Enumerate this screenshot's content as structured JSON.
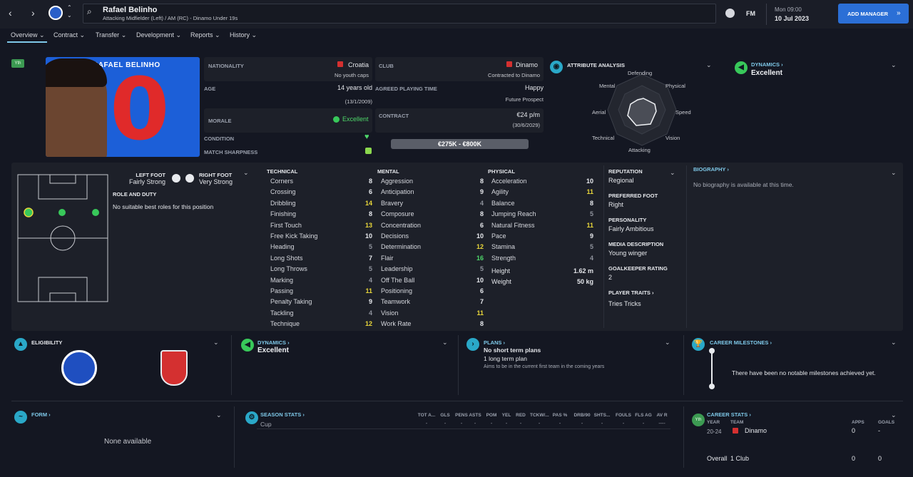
{
  "topbar": {
    "player_name": "Rafael Belinho",
    "player_sub": "Attacking Midfielder (Left) / AM (RC) - Dinamo Under 19s",
    "fm": "FM",
    "time": "Mon 09:00",
    "date": "10 Jul 2023",
    "add_manager": "ADD MANAGER"
  },
  "tabs": [
    "Overview",
    "Contract",
    "Transfer",
    "Development",
    "Reports",
    "History"
  ],
  "profile": {
    "badge": "Yth",
    "shirt_name": "RAFAEL BELINHO",
    "shirt_number": "0",
    "nationality_label": "NATIONALITY",
    "nationality": "Croatia",
    "youth_caps": "No youth caps",
    "age_label": "AGE",
    "age": "14 years old",
    "dob": "(13/1/2009)",
    "morale_label": "MORALE",
    "morale": "Excellent",
    "condition_label": "CONDITION",
    "sharpness_label": "MATCH SHARPNESS",
    "club_label": "CLUB",
    "club": "Dinamo",
    "contracted": "Contracted to Dinamo",
    "playing_time_label": "AGREED PLAYING TIME",
    "happy": "Happy",
    "playing_time": "Future Prospect",
    "contract_label": "CONTRACT",
    "wage": "€24 p/m",
    "expiry": "(30/6/2029)",
    "value": "€275K - €800K"
  },
  "attribute_analysis": {
    "title": "ATTRIBUTE ANALYSIS",
    "labels": [
      "Defending",
      "Physical",
      "Speed",
      "Vision",
      "Attacking",
      "Technical",
      "Aerial",
      "Mental"
    ]
  },
  "dynamics_top": {
    "title": "DYNAMICS",
    "value": "Excellent"
  },
  "position": {
    "left_foot_label": "LEFT FOOT",
    "left_foot": "Fairly Strong",
    "right_foot_label": "RIGHT FOOT",
    "right_foot": "Very Strong",
    "role_title": "ROLE AND DUTY",
    "role_text": "No suitable best roles for this position"
  },
  "technical": {
    "title": "TECHNICAL",
    "items": [
      [
        "Corners",
        "8",
        "w"
      ],
      [
        "Crossing",
        "6",
        "w"
      ],
      [
        "Dribbling",
        "14",
        "y"
      ],
      [
        "Finishing",
        "8",
        "w"
      ],
      [
        "First Touch",
        "13",
        "y"
      ],
      [
        "Free Kick Taking",
        "10",
        "w"
      ],
      [
        "Heading",
        "5",
        "gr"
      ],
      [
        "Long Shots",
        "7",
        "w"
      ],
      [
        "Long Throws",
        "5",
        "gr"
      ],
      [
        "Marking",
        "4",
        "gr"
      ],
      [
        "Passing",
        "11",
        "y"
      ],
      [
        "Penalty Taking",
        "9",
        "w"
      ],
      [
        "Tackling",
        "4",
        "gr"
      ],
      [
        "Technique",
        "12",
        "y"
      ]
    ]
  },
  "mental": {
    "title": "MENTAL",
    "items": [
      [
        "Aggression",
        "8",
        "w"
      ],
      [
        "Anticipation",
        "9",
        "w"
      ],
      [
        "Bravery",
        "4",
        "gr"
      ],
      [
        "Composure",
        "8",
        "w"
      ],
      [
        "Concentration",
        "6",
        "w"
      ],
      [
        "Decisions",
        "10",
        "w"
      ],
      [
        "Determination",
        "12",
        "y"
      ],
      [
        "Flair",
        "16",
        "g"
      ],
      [
        "Leadership",
        "5",
        "gr"
      ],
      [
        "Off The Ball",
        "10",
        "w"
      ],
      [
        "Positioning",
        "6",
        "w"
      ],
      [
        "Teamwork",
        "7",
        "w"
      ],
      [
        "Vision",
        "11",
        "y"
      ],
      [
        "Work Rate",
        "8",
        "w"
      ]
    ]
  },
  "physical": {
    "title": "PHYSICAL",
    "items": [
      [
        "Acceleration",
        "10",
        "w"
      ],
      [
        "Agility",
        "11",
        "y"
      ],
      [
        "Balance",
        "8",
        "w"
      ],
      [
        "Jumping Reach",
        "5",
        "gr"
      ],
      [
        "Natural Fitness",
        "11",
        "y"
      ],
      [
        "Pace",
        "9",
        "w"
      ],
      [
        "Stamina",
        "5",
        "gr"
      ],
      [
        "Strength",
        "4",
        "gr"
      ]
    ],
    "height_label": "Height",
    "height": "1.62 m",
    "weight_label": "Weight",
    "weight": "50 kg"
  },
  "info": {
    "reputation_label": "REPUTATION",
    "reputation": "Regional",
    "foot_label": "PREFERRED FOOT",
    "foot": "Right",
    "personality_label": "PERSONALITY",
    "personality": "Fairly Ambitious",
    "media_label": "MEDIA DESCRIPTION",
    "media": "Young winger",
    "gk_label": "GOALKEEPER RATING",
    "gk": "2",
    "traits_label": "PLAYER TRAITS",
    "traits": "Tries Tricks"
  },
  "biography": {
    "title": "BIOGRAPHY",
    "text": "No biography is available at this time."
  },
  "eligibility": {
    "title": "ELIGIBILITY"
  },
  "dynamics_mid": {
    "title": "DYNAMICS",
    "value": "Excellent"
  },
  "plans": {
    "title": "PLANS",
    "line1": "No short term plans",
    "line2": "1 long term plan",
    "line3": "Aims to be in the current first team in the coming years"
  },
  "milestones": {
    "title": "CAREER MILESTONES",
    "text": "There have been no notable milestones achieved yet."
  },
  "form": {
    "title": "FORM",
    "text": "None available"
  },
  "season_stats": {
    "title": "SEASON STATS",
    "cols": [
      "TOT A...",
      "GLS",
      "PENS",
      "ASTS",
      "POM",
      "YEL",
      "RED",
      "TCKW/...",
      "PAS %",
      "DRB/90",
      "SHTS...",
      "FOULS",
      "FLS AG",
      "AV R"
    ],
    "row_label": "Cup",
    "row_values": [
      "-",
      "-",
      "-",
      "-",
      "-",
      "-",
      "-",
      "-",
      "-",
      "-",
      "-",
      "-",
      "-",
      "----"
    ]
  },
  "career_stats": {
    "title": "CAREER STATS",
    "badge": "Yth",
    "year_label": "YEAR",
    "team_label": "TEAM",
    "apps_label": "APPS",
    "goals_label": "GOALS",
    "year": "20-24",
    "team": "Dinamo",
    "apps": "0",
    "goals": "-",
    "overall": "Overall",
    "clubs": "1 Club",
    "total_apps": "0",
    "total_goals": "0"
  },
  "colors": {
    "accent": "#2b6fd6",
    "cyan": "#2aa8c8",
    "green": "#38c85a",
    "yellow": "#e8d63a"
  }
}
